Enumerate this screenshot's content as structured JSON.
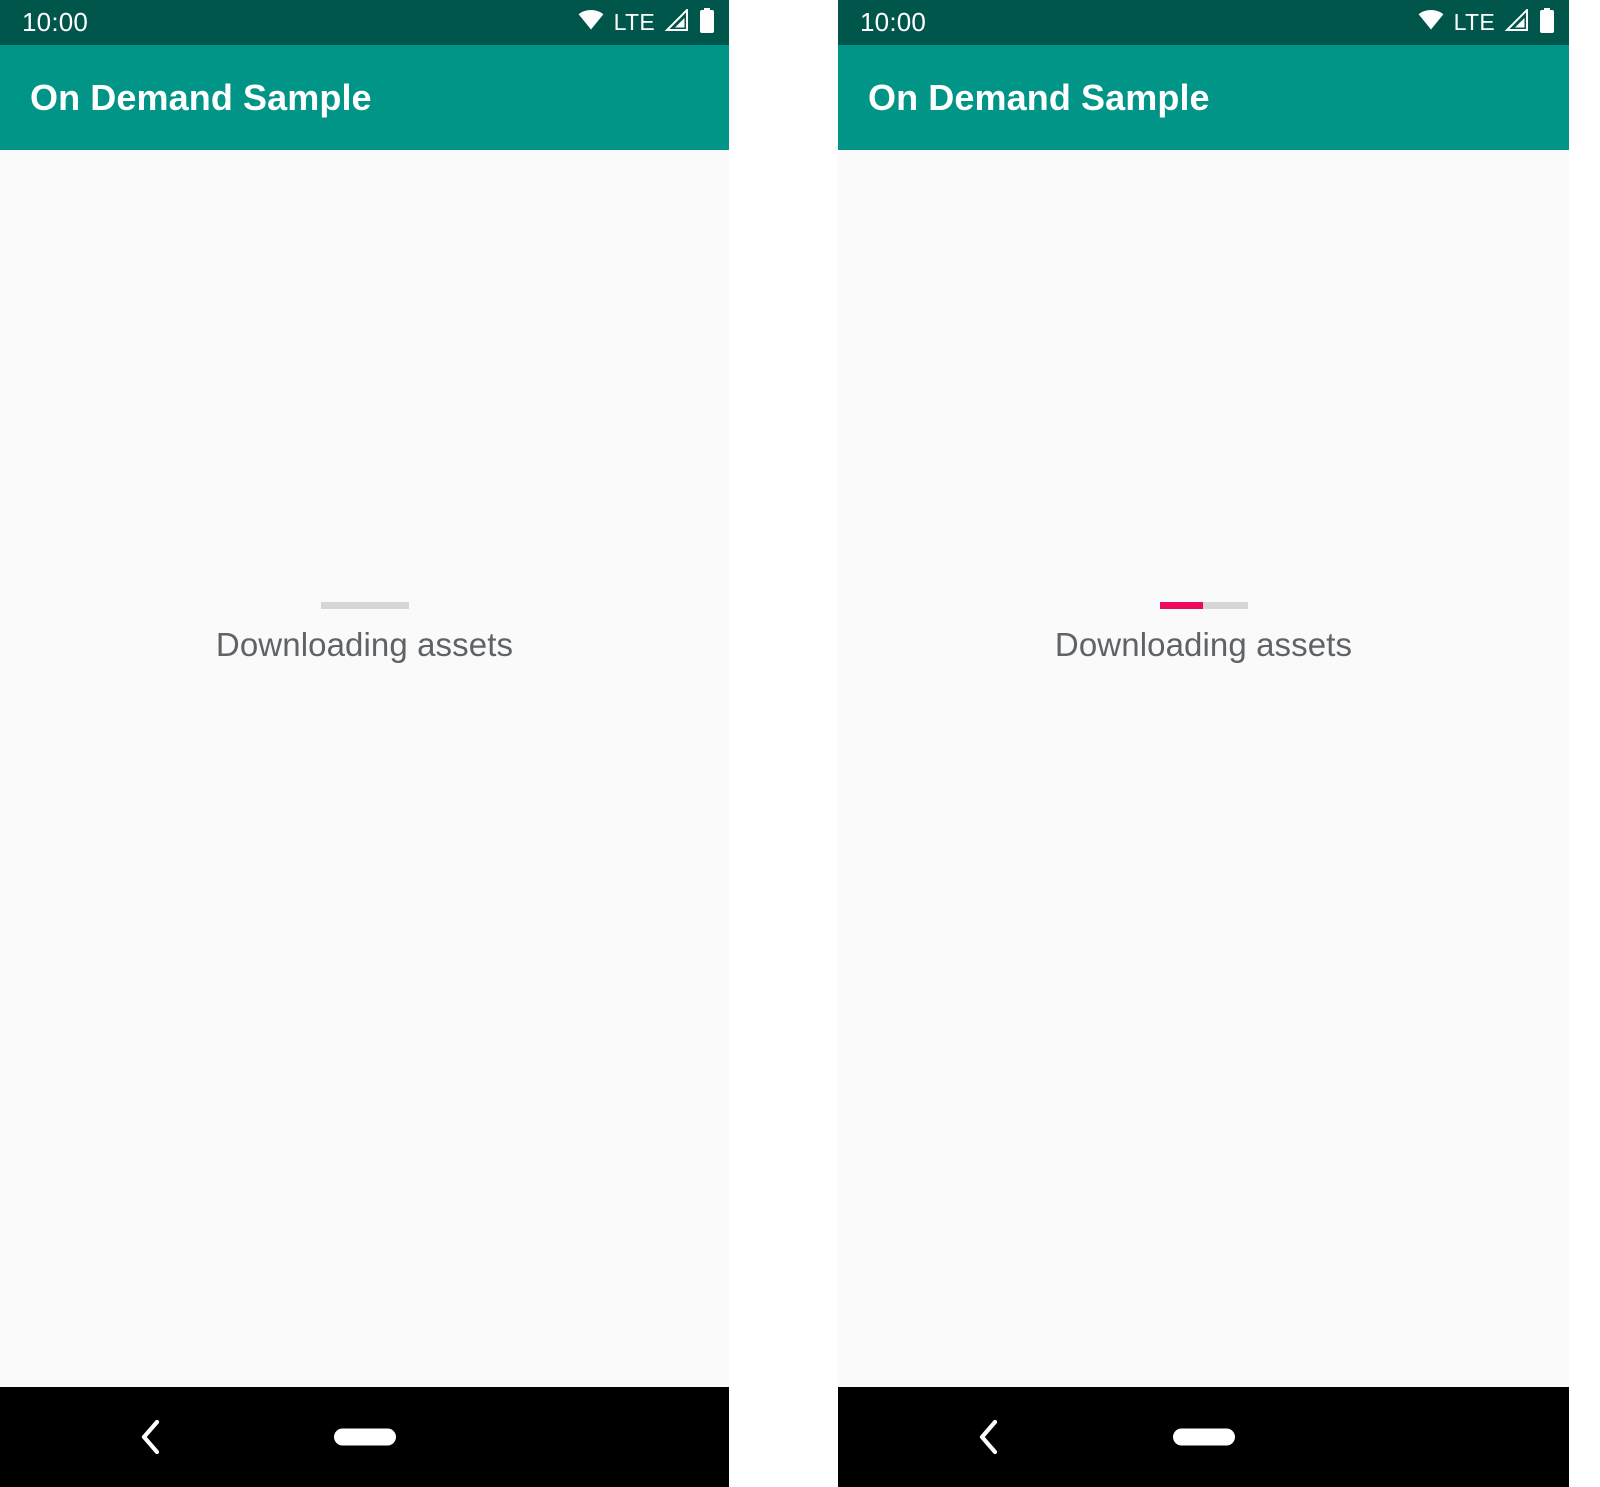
{
  "meta": {
    "app_title": "On Demand Sample",
    "accent_color": "#009587",
    "status_bar_color": "#00564a",
    "progress_fill_color": "#ec0a5e",
    "progress_track_color": "#d6d6d6",
    "background_color": "#fafafa",
    "label_color": "#5f6368"
  },
  "panels": [
    {
      "id": "panel-before",
      "status_bar": {
        "clock": "10:00",
        "network_label": "LTE",
        "icons": [
          "wifi-icon",
          "lte-label",
          "cellular-signal-icon",
          "battery-icon"
        ]
      },
      "app_bar": {
        "title": "On Demand Sample"
      },
      "content": {
        "loading_label": "Downloading assets",
        "progress": {
          "value": 0,
          "max": 100,
          "display": "0%"
        }
      },
      "nav_bar": {
        "back_label": "Back",
        "home_label": "Home"
      }
    },
    {
      "id": "panel-after",
      "status_bar": {
        "clock": "10:00",
        "network_label": "LTE",
        "icons": [
          "wifi-icon",
          "lte-label",
          "cellular-signal-icon",
          "battery-icon"
        ]
      },
      "app_bar": {
        "title": "On Demand Sample"
      },
      "content": {
        "loading_label": "Downloading assets",
        "progress": {
          "value": 49,
          "max": 100,
          "display": "49%"
        }
      },
      "nav_bar": {
        "back_label": "Back",
        "home_label": "Home"
      }
    }
  ]
}
